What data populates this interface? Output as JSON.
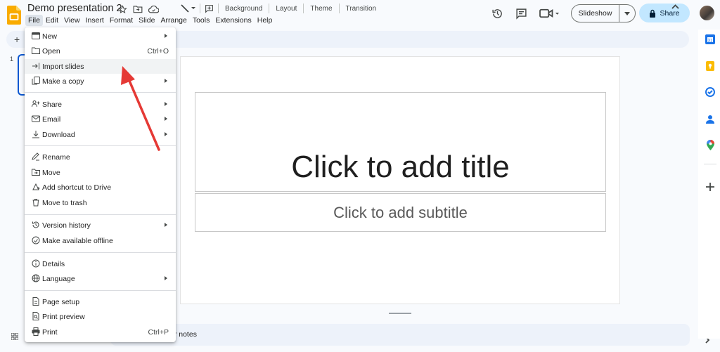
{
  "header": {
    "doc_title": "Demo presentation 2",
    "menus": [
      "File",
      "Edit",
      "View",
      "Insert",
      "Format",
      "Slide",
      "Arrange",
      "Tools",
      "Extensions",
      "Help"
    ],
    "slideshow_label": "Slideshow",
    "share_label": "Share"
  },
  "toolbar": {
    "background_label": "Background",
    "layout_label": "Layout",
    "theme_label": "Theme",
    "transition_label": "Transition"
  },
  "filmstrip": {
    "slide_number": "1"
  },
  "slide": {
    "title_placeholder": "Click to add title",
    "subtitle_placeholder": "Click to add subtitle"
  },
  "notes": {
    "label": "er notes"
  },
  "file_menu": {
    "new": "New",
    "open": "Open",
    "open_shortcut": "Ctrl+O",
    "import_slides": "Import slides",
    "make_copy": "Make a copy",
    "share": "Share",
    "email": "Email",
    "download": "Download",
    "rename": "Rename",
    "move": "Move",
    "add_shortcut": "Add shortcut to Drive",
    "move_trash": "Move to trash",
    "version_history": "Version history",
    "offline": "Make available offline",
    "details": "Details",
    "language": "Language",
    "page_setup": "Page setup",
    "print_preview": "Print preview",
    "print": "Print",
    "print_shortcut": "Ctrl+P"
  },
  "colors": {
    "accent_blue": "#0b57d0",
    "share_bg": "#c2e7ff",
    "annotation_arrow": "#e53935",
    "slides_yellow": "#f9ab00"
  }
}
